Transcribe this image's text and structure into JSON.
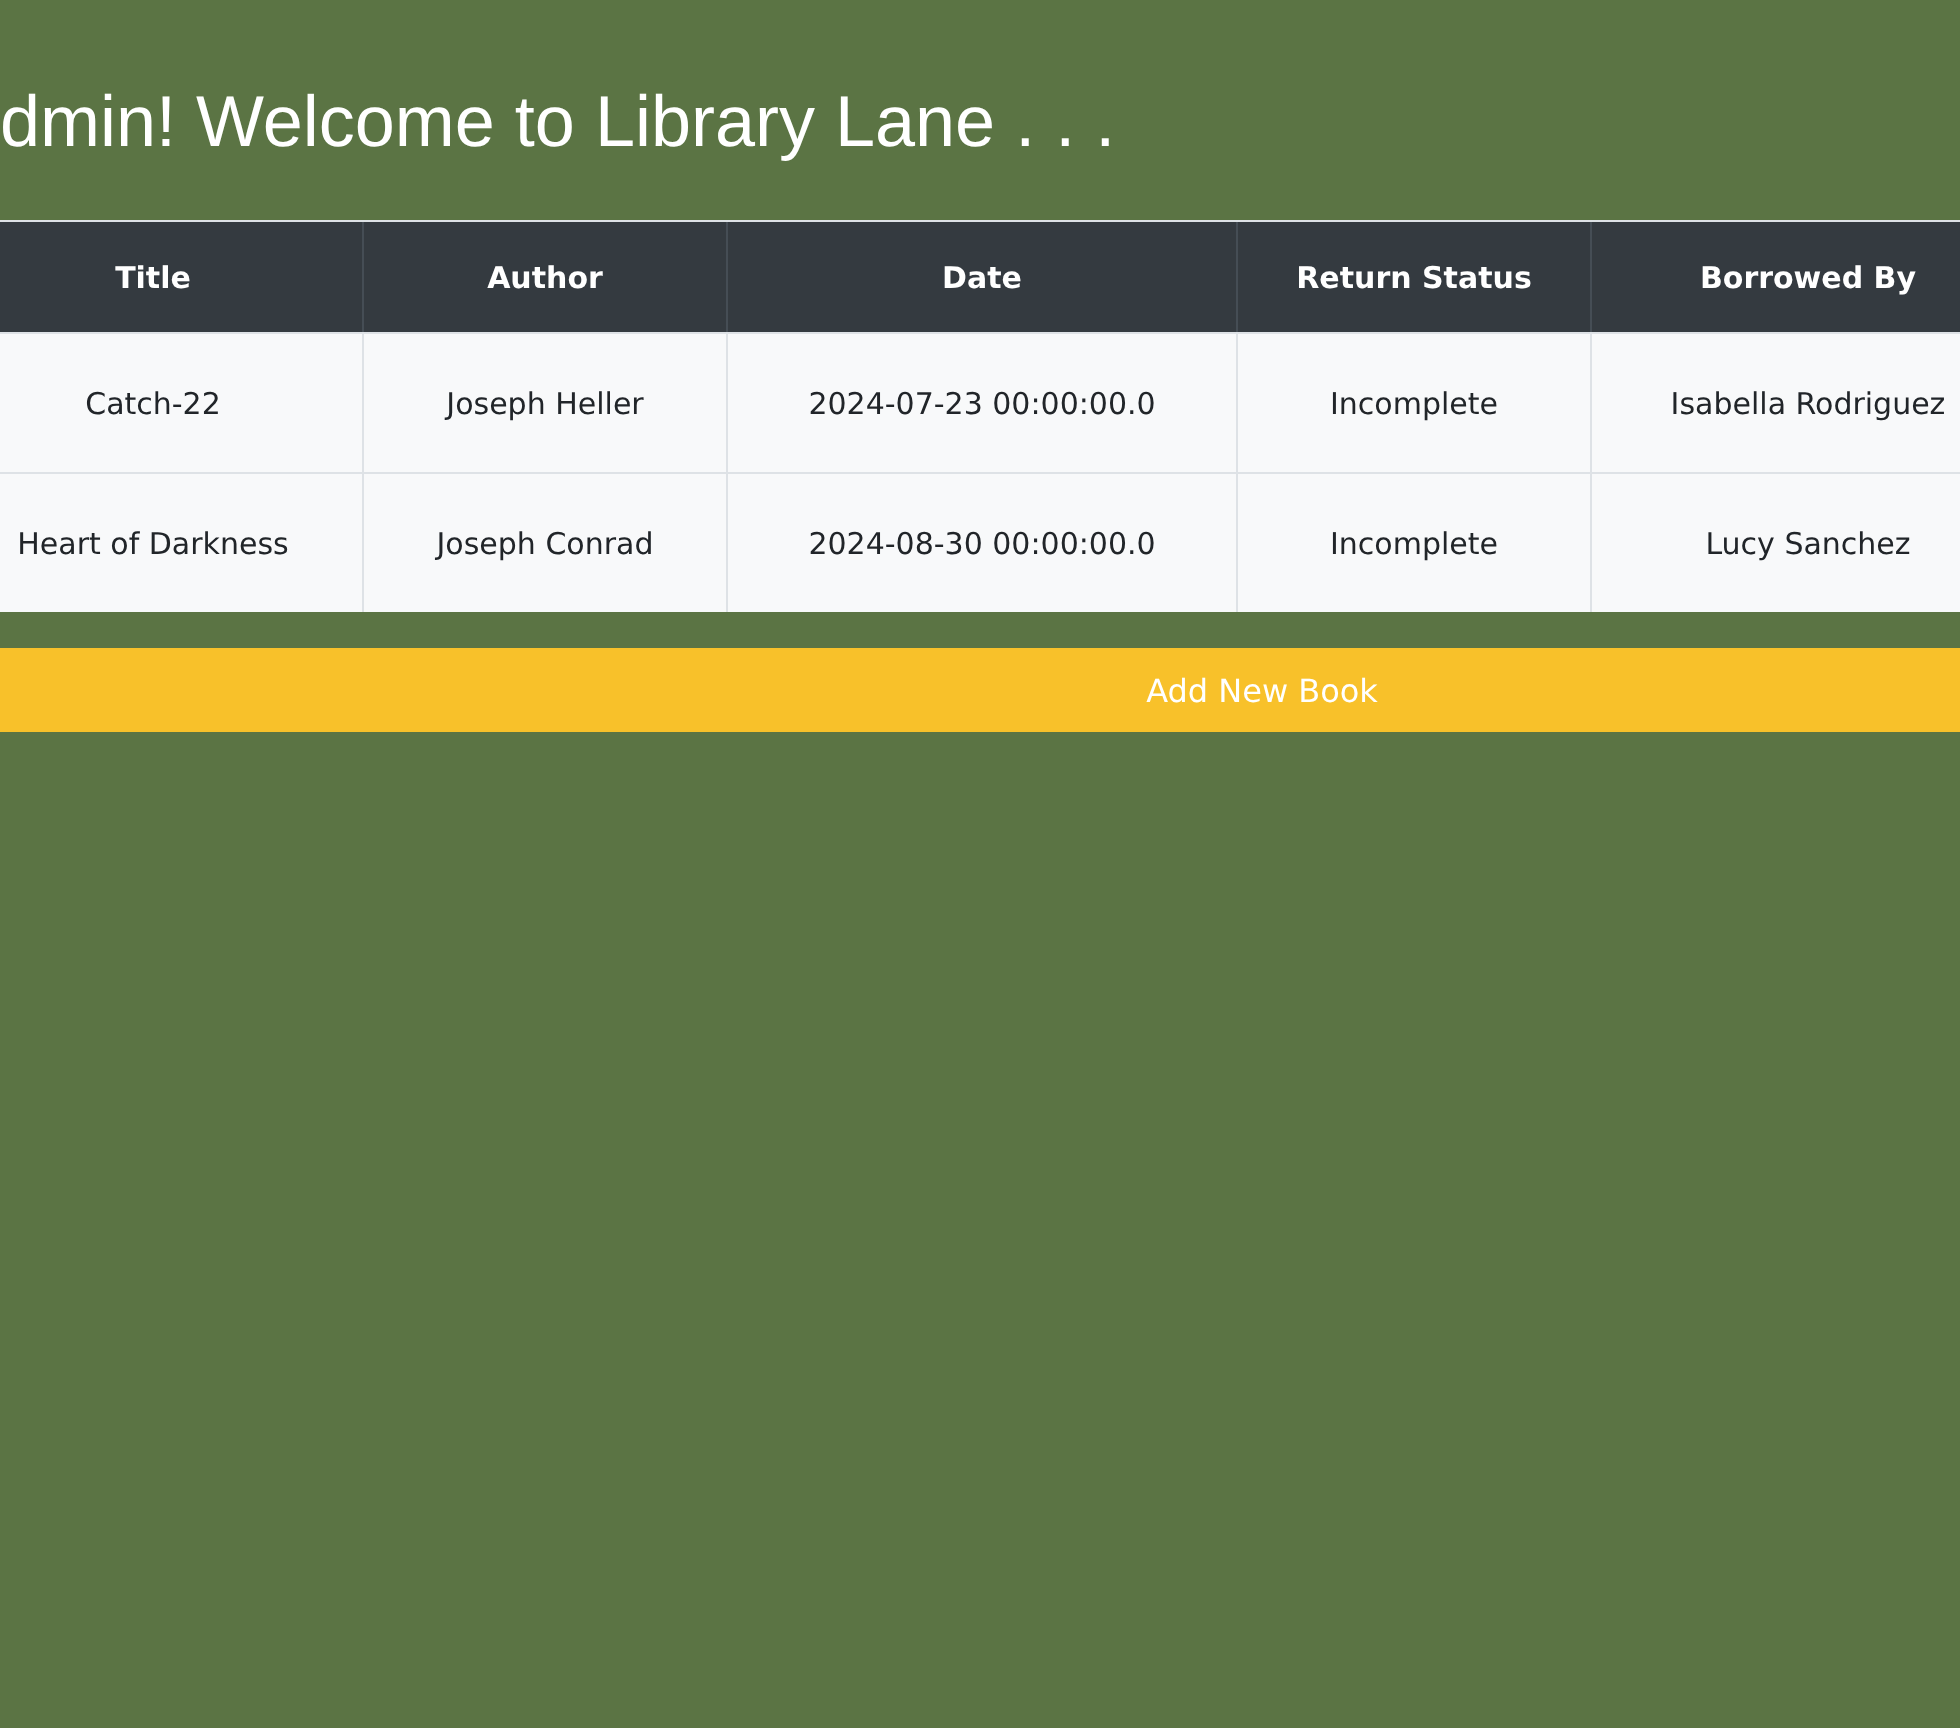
{
  "heading": "dmin! Welcome to Library Lane . . .",
  "table": {
    "columns": [
      "Title",
      "Author",
      "Date",
      "Return Status",
      "Borrowed By"
    ],
    "rows": [
      [
        "Catch-22",
        "Joseph Heller",
        "2024-07-23 00:00:00.0",
        "Incomplete",
        "Isabella Rodriguez"
      ],
      [
        "Heart of Darkness",
        "Joseph Conrad",
        "2024-08-30 00:00:00.0",
        "Incomplete",
        "Lucy Sanchez"
      ]
    ]
  },
  "button": "Add New Book"
}
